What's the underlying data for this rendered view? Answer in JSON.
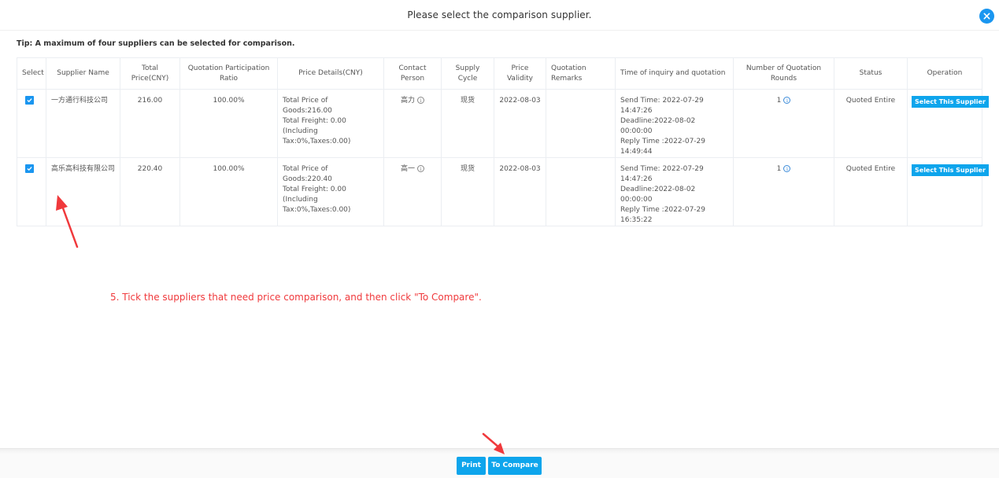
{
  "dialog": {
    "title": "Please select the comparison supplier.",
    "close_icon": "close-circle-icon",
    "tip": "Tip: A maximum of four suppliers can be selected for comparison."
  },
  "table": {
    "headers": {
      "select": "Select",
      "supplier_name": "Supplier Name",
      "total_price": "Total Price(CNY)",
      "participation_ratio": "Quotation Participation Ratio",
      "price_details": "Price Details(CNY)",
      "contact_person": "Contact Person",
      "supply_cycle": "Supply Cycle",
      "price_validity": "Price Validity",
      "quotation_remarks": "Quotation Remarks",
      "time_info": "Time of inquiry and quotation",
      "rounds": "Number of Quotation Rounds",
      "status": "Status",
      "operation": "Operation"
    },
    "rows": [
      {
        "selected": true,
        "supplier_name": "一方通行科技公司",
        "total_price": "216.00",
        "participation_ratio": "100.00%",
        "price_details": {
          "goods": "Total Price of Goods:216.00",
          "freight": "Total Freight: 0.00",
          "including": "(Including",
          "tax": "Tax:0%,Taxes:0.00)"
        },
        "contact_person": "高力",
        "supply_cycle": "现货",
        "price_validity": "2022-08-03",
        "quotation_remarks": "",
        "time_info": {
          "send": "Send Time: 2022-07-29",
          "send_time": "14:47:26",
          "deadline": "Deadline:2022-08-02 00:00:00",
          "reply": "Reply Time :2022-07-29",
          "reply_time": "14:49:44"
        },
        "rounds": "1",
        "status": "Quoted Entire",
        "operation_label": "Select This Supplier"
      },
      {
        "selected": true,
        "supplier_name": "高乐高科技有限公司",
        "total_price": "220.40",
        "participation_ratio": "100.00%",
        "price_details": {
          "goods": "Total Price of Goods:220.40",
          "freight": "Total Freight: 0.00",
          "including": "(Including",
          "tax": "Tax:0%,Taxes:0.00)"
        },
        "contact_person": "高一",
        "supply_cycle": "现货",
        "price_validity": "2022-08-03",
        "quotation_remarks": "",
        "time_info": {
          "send": "Send Time: 2022-07-29",
          "send_time": "14:47:26",
          "deadline": "Deadline:2022-08-02 00:00:00",
          "reply": "Reply Time :2022-07-29",
          "reply_time": "16:35:22"
        },
        "rounds": "1",
        "status": "Quoted Entire",
        "operation_label": "Select This Supplier"
      }
    ]
  },
  "annotation": {
    "text": "5. Tick the suppliers that need price comparison, and then click \"To Compare\".",
    "color": "#f0393c"
  },
  "footer": {
    "print_label": "Print",
    "compare_label": "To Compare"
  },
  "colors": {
    "accent": "#0ea5ec",
    "close": "#1a96f0",
    "annotation": "#f0393c"
  }
}
